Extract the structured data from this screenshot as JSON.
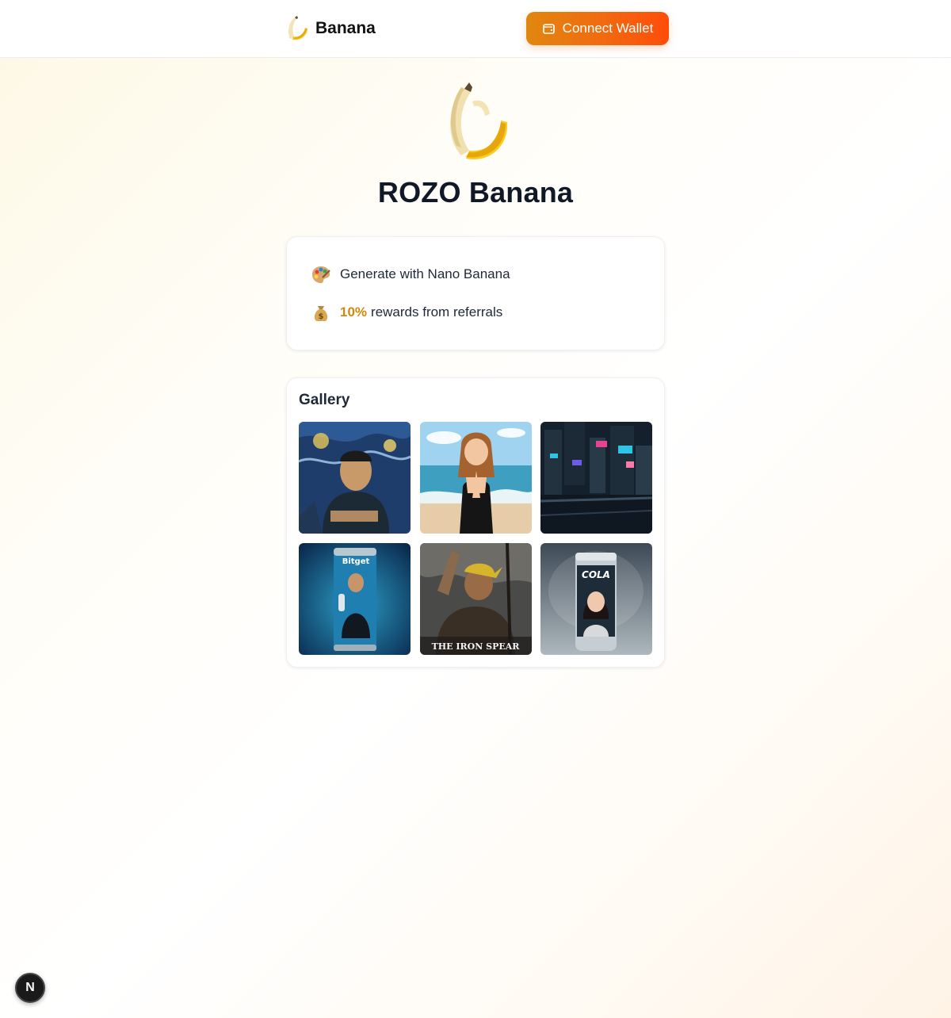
{
  "header": {
    "brand_name": "Banana",
    "logo_icon": "banana-icon",
    "connect_label": "Connect Wallet",
    "connect_icon": "wallet-icon"
  },
  "hero": {
    "icon": "banana-icon",
    "title": "ROZO Banana"
  },
  "features": [
    {
      "icon": "palette-icon",
      "highlight": "",
      "text": "Generate with Nano Banana"
    },
    {
      "icon": "money-bag-icon",
      "highlight": "10%",
      "text": "rewards from referrals"
    }
  ],
  "gallery": {
    "title": "Gallery",
    "items": [
      {
        "caption": ""
      },
      {
        "caption": ""
      },
      {
        "caption": ""
      },
      {
        "caption": "Bitget"
      },
      {
        "caption": "THE IRON SPEAR"
      },
      {
        "caption": "COLA"
      }
    ]
  },
  "badge": {
    "label": "N"
  },
  "colors": {
    "accent_start": "#e0870f",
    "accent_end": "#ff4d0a",
    "highlight": "#d1890a"
  }
}
